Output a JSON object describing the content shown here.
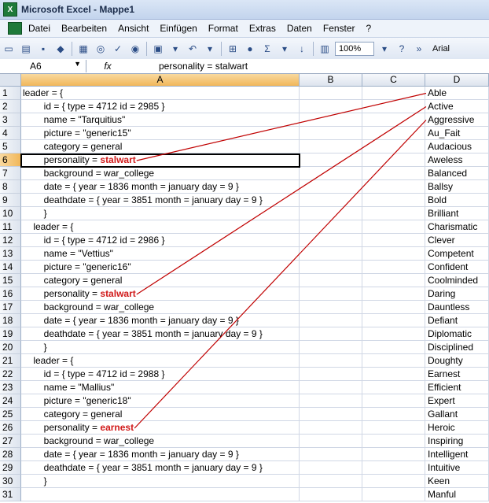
{
  "window": {
    "title": "Microsoft Excel - Mappe1"
  },
  "menu": [
    "Datei",
    "Bearbeiten",
    "Ansicht",
    "Einfügen",
    "Format",
    "Extras",
    "Daten",
    "Fenster",
    "?"
  ],
  "toolbar": {
    "zoom": "100%",
    "font": "Arial"
  },
  "formula_bar": {
    "cell_ref": "A6",
    "fx": "fx",
    "content": "personality = stalwart"
  },
  "columns": [
    "A",
    "B",
    "C",
    "D"
  ],
  "rows": [
    {
      "n": "1",
      "a": "leader = {",
      "hl": "",
      "d": "Able"
    },
    {
      "n": "2",
      "a": "        id = { type = 4712 id = 2985 }",
      "hl": "",
      "d": "Active"
    },
    {
      "n": "3",
      "a": "        name = \"Tarquitius\"",
      "hl": "",
      "d": "Aggressive"
    },
    {
      "n": "4",
      "a": "        picture = \"generic15\"",
      "hl": "",
      "d": "Au_Fait"
    },
    {
      "n": "5",
      "a": "        category = general",
      "hl": "",
      "d": "Audacious"
    },
    {
      "n": "6",
      "a": "        personality = ",
      "hl": "stalwart",
      "d": "Aweless"
    },
    {
      "n": "7",
      "a": "        background = war_college",
      "hl": "",
      "d": "Balanced"
    },
    {
      "n": "8",
      "a": "        date = { year = 1836 month = january day = 9 }",
      "hl": "",
      "d": "Ballsy"
    },
    {
      "n": "9",
      "a": "        deathdate = { year = 3851 month = january day = 9 }",
      "hl": "",
      "d": "Bold"
    },
    {
      "n": "10",
      "a": "        }",
      "hl": "",
      "d": "Brilliant"
    },
    {
      "n": "11",
      "a": "    leader = {",
      "hl": "",
      "d": "Charismatic"
    },
    {
      "n": "12",
      "a": "        id = { type = 4712 id = 2986 }",
      "hl": "",
      "d": "Clever"
    },
    {
      "n": "13",
      "a": "        name = \"Vettius\"",
      "hl": "",
      "d": "Competent"
    },
    {
      "n": "14",
      "a": "        picture = \"generic16\"",
      "hl": "",
      "d": "Confident"
    },
    {
      "n": "15",
      "a": "        category = general",
      "hl": "",
      "d": "Coolminded"
    },
    {
      "n": "16",
      "a": "        personality = ",
      "hl": "stalwart",
      "d": "Daring"
    },
    {
      "n": "17",
      "a": "        background = war_college",
      "hl": "",
      "d": "Dauntless"
    },
    {
      "n": "18",
      "a": "        date = { year = 1836 month = january day = 9 }",
      "hl": "",
      "d": "Defiant"
    },
    {
      "n": "19",
      "a": "        deathdate = { year = 3851 month = january day = 9 }",
      "hl": "",
      "d": "Diplomatic"
    },
    {
      "n": "20",
      "a": "        }",
      "hl": "",
      "d": "Disciplined"
    },
    {
      "n": "21",
      "a": "    leader = {",
      "hl": "",
      "d": "Doughty"
    },
    {
      "n": "22",
      "a": "        id = { type = 4712 id = 2988 }",
      "hl": "",
      "d": "Earnest"
    },
    {
      "n": "23",
      "a": "        name = \"Mallius\"",
      "hl": "",
      "d": "Efficient"
    },
    {
      "n": "24",
      "a": "        picture = \"generic18\"",
      "hl": "",
      "d": "Expert"
    },
    {
      "n": "25",
      "a": "        category = general",
      "hl": "",
      "d": "Gallant"
    },
    {
      "n": "26",
      "a": "        personality = ",
      "hl": "earnest",
      "d": "Heroic"
    },
    {
      "n": "27",
      "a": "        background = war_college",
      "hl": "",
      "d": "Inspiring"
    },
    {
      "n": "28",
      "a": "        date = { year = 1836 month = january day = 9 }",
      "hl": "",
      "d": "Intelligent"
    },
    {
      "n": "29",
      "a": "        deathdate = { year = 3851 month = january day = 9 }",
      "hl": "",
      "d": "Intuitive"
    },
    {
      "n": "30",
      "a": "        }",
      "hl": "",
      "d": "Keen"
    },
    {
      "n": "31",
      "a": "",
      "hl": "",
      "d": "Manful"
    }
  ],
  "connections": [
    {
      "from_row": 6,
      "to_row": 1
    },
    {
      "from_row": 16,
      "to_row": 2
    },
    {
      "from_row": 26,
      "to_row": 3
    }
  ],
  "colors": {
    "highlight": "#d11a1a",
    "line": "#c00000"
  }
}
